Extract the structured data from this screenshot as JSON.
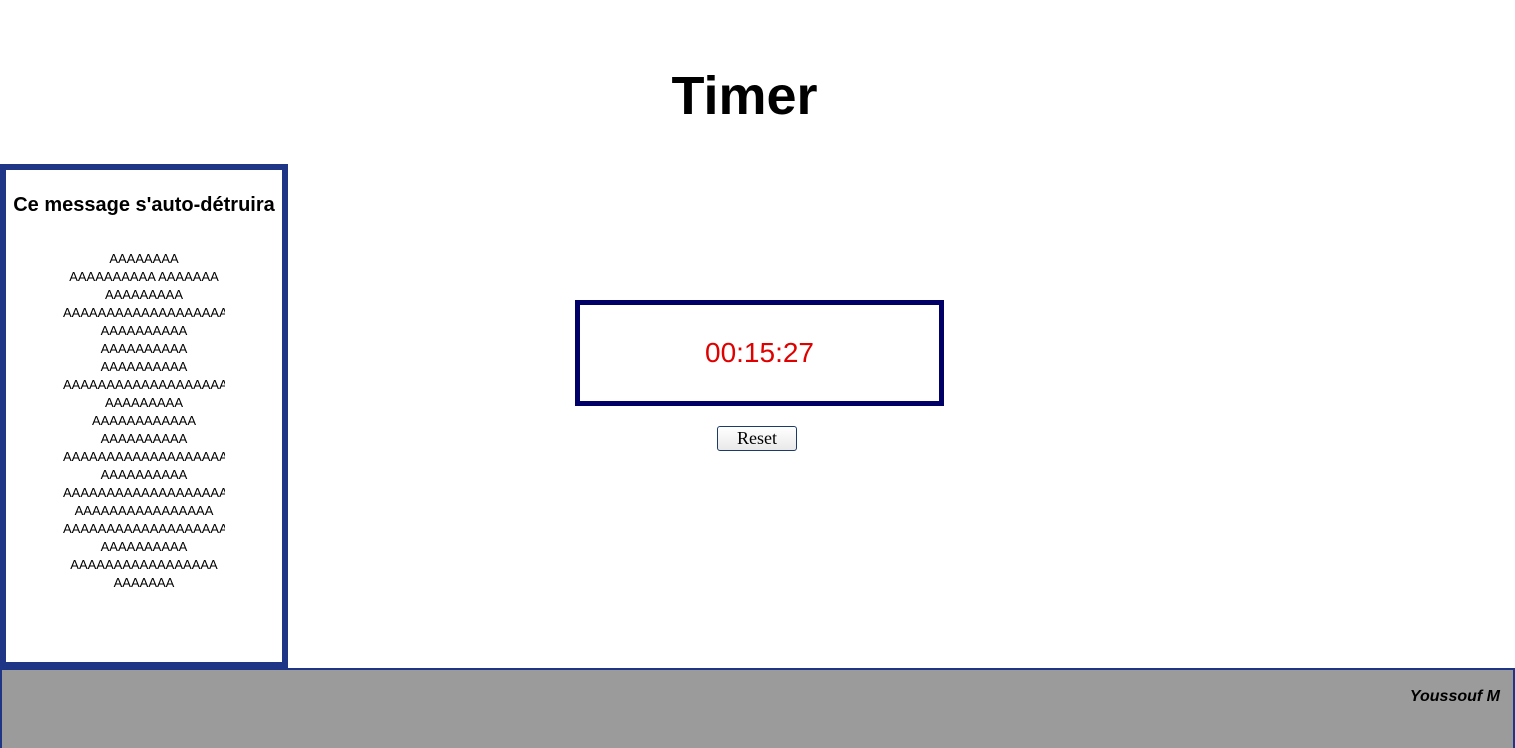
{
  "header": {
    "title": "Timer"
  },
  "sidebar": {
    "title": "Ce message s'auto-détruira",
    "lines": [
      "AAAAAAAA",
      "AAAAAAAAAA AAAAAAA",
      "AAAAAAAAA",
      "AAAAAAAAAAAAAAAAAAAA",
      "AAAAAAAAAA",
      "AAAAAAAAAA",
      "AAAAAAAAAA",
      "AAAAAAAAAAAAAAAAAAAA",
      "AAAAAAAAA",
      "AAAAAAAAAAAA",
      "AAAAAAAAAA",
      "AAAAAAAAAAAAAAAAAAAA",
      "AAAAAAAAAA",
      "AAAAAAAAAAAAAAAAAAAA",
      "AAAAAAAAAAAAAAAA",
      "AAAAAAAAAAAAAAAAAAAA",
      "AAAAAAAAAA",
      "AAAAAAAAAAAAAAAAA",
      "AAAAAAA"
    ],
    "border_color": "#1f3585"
  },
  "timer": {
    "value": "00:15:27",
    "value_color": "#e00000",
    "border_color": "#000066"
  },
  "controls": {
    "reset_label": "Reset"
  },
  "footer": {
    "author": "Youssouf M",
    "background_color": "#9b9b9b"
  }
}
